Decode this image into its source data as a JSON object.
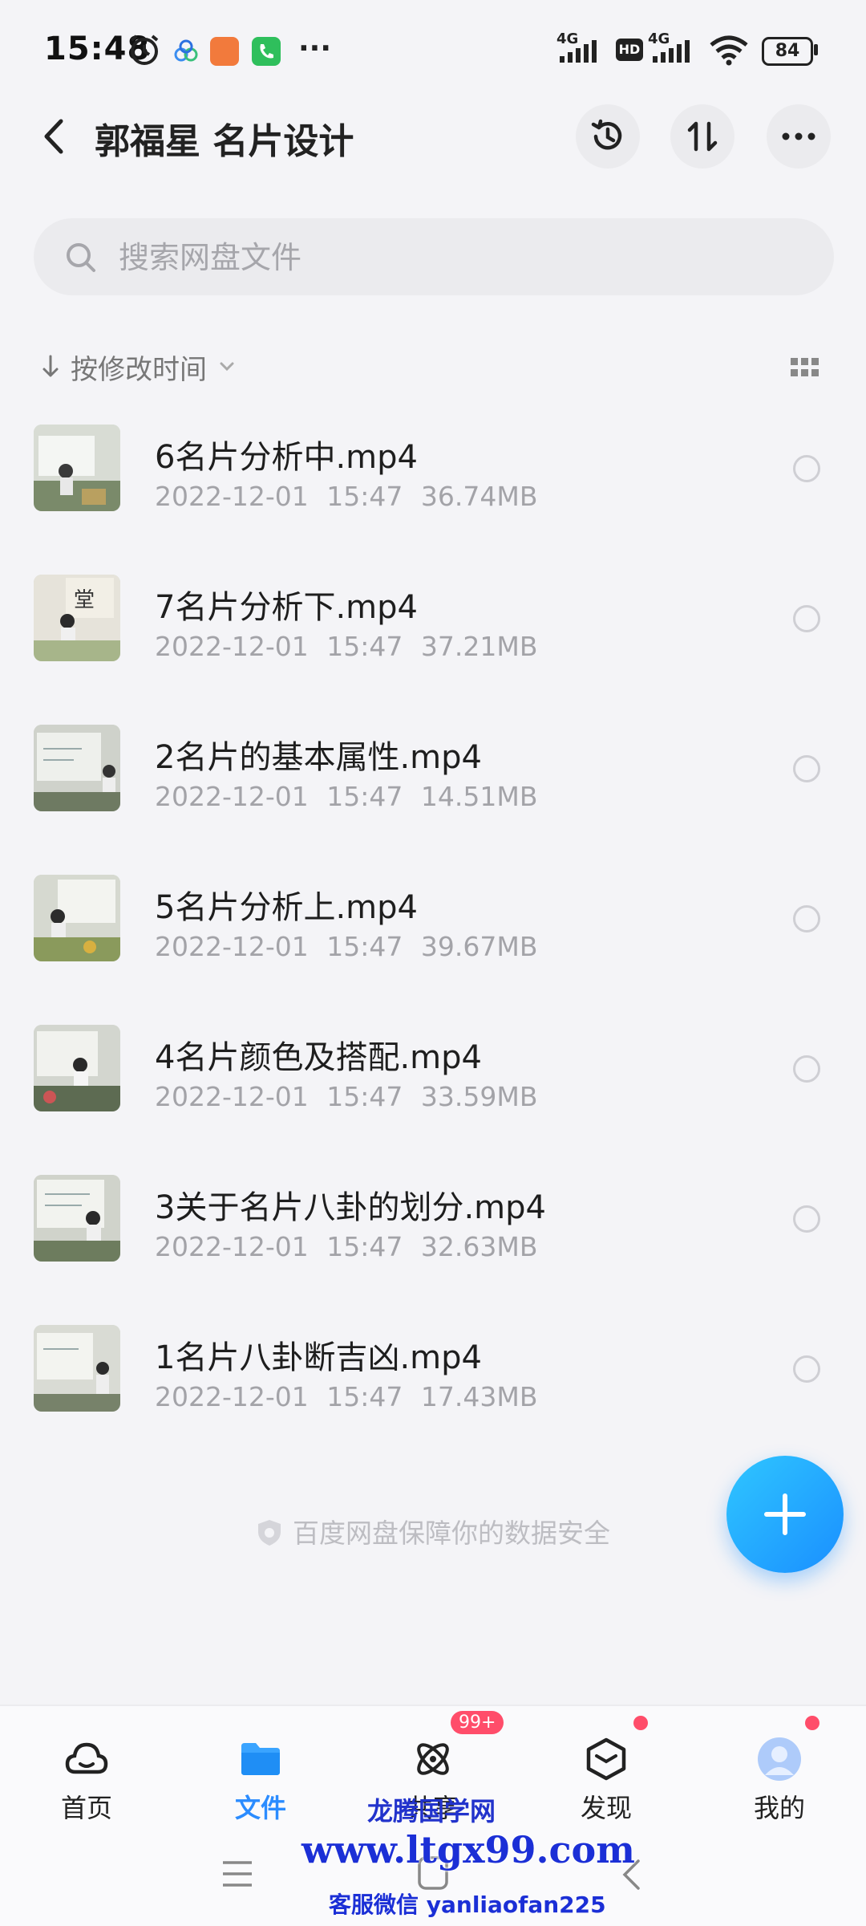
{
  "status_bar": {
    "time": "15:48",
    "signal1": "4G",
    "hd": "HD",
    "signal2": "4G",
    "battery": "84"
  },
  "header": {
    "title": "郭福星 名片设计"
  },
  "search": {
    "placeholder": "搜索网盘文件"
  },
  "sort": {
    "label": "按修改时间"
  },
  "files": [
    {
      "name": "6名片分析中.mp4",
      "date": "2022-12-01",
      "time": "15:47",
      "size": "36.74MB"
    },
    {
      "name": "7名片分析下.mp4",
      "date": "2022-12-01",
      "time": "15:47",
      "size": "37.21MB"
    },
    {
      "name": "2名片的基本属性.mp4",
      "date": "2022-12-01",
      "time": "15:47",
      "size": "14.51MB"
    },
    {
      "name": "5名片分析上.mp4",
      "date": "2022-12-01",
      "time": "15:47",
      "size": "39.67MB"
    },
    {
      "name": "4名片颜色及搭配.mp4",
      "date": "2022-12-01",
      "time": "15:47",
      "size": "33.59MB"
    },
    {
      "name": "3关于名片八卦的划分.mp4",
      "date": "2022-12-01",
      "time": "15:47",
      "size": "32.63MB"
    },
    {
      "name": "1名片八卦断吉凶.mp4",
      "date": "2022-12-01",
      "time": "15:47",
      "size": "17.43MB"
    }
  ],
  "safety_note": "百度网盘保障你的数据安全",
  "nav": {
    "home": "首页",
    "files": "文件",
    "share": "共享",
    "share_badge": "99+",
    "discover": "发现",
    "mine": "我的"
  },
  "watermark": {
    "line1": "龙腾国学网",
    "line2": "www.ltgx99.com",
    "line3": "客服微信 yanliaofan225"
  },
  "colors": {
    "accent": "#2b8cff",
    "badge": "#ff4d6a",
    "background": "#f4f4f7"
  }
}
